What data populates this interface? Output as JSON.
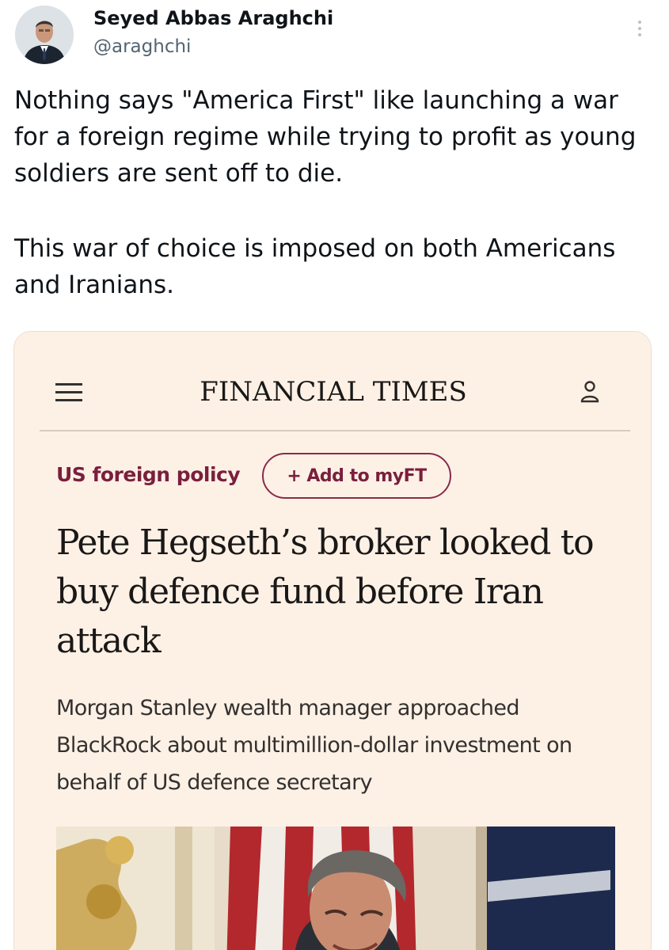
{
  "author": {
    "name": "Seyed Abbas Araghchi",
    "handle": "@araghchi"
  },
  "tweet": {
    "paragraphs": [
      "Nothing says \"America First\" like launching a war for a foreign regime while trying to profit as young soldiers are sent off to die.",
      "This war of choice is imposed on both Americans and Iranians."
    ]
  },
  "article": {
    "publication": "FINANCIAL TIMES",
    "topic": "US foreign policy",
    "follow_button": "+ Add to myFT",
    "headline": "Pete Hegseth’s broker looked to buy defence fund before Iran attack",
    "standfirst": "Morgan Stanley wealth manager approached BlackRock about multimillion-dollar investment on behalf of US defence secretary"
  },
  "icons": {
    "more": "more-vertical-icon",
    "menu": "hamburger-menu-icon",
    "user": "user-account-icon"
  },
  "colors": {
    "card_background": "#fdf1e6",
    "topic_accent": "#7a1f3d",
    "handle_gray": "#536471"
  }
}
